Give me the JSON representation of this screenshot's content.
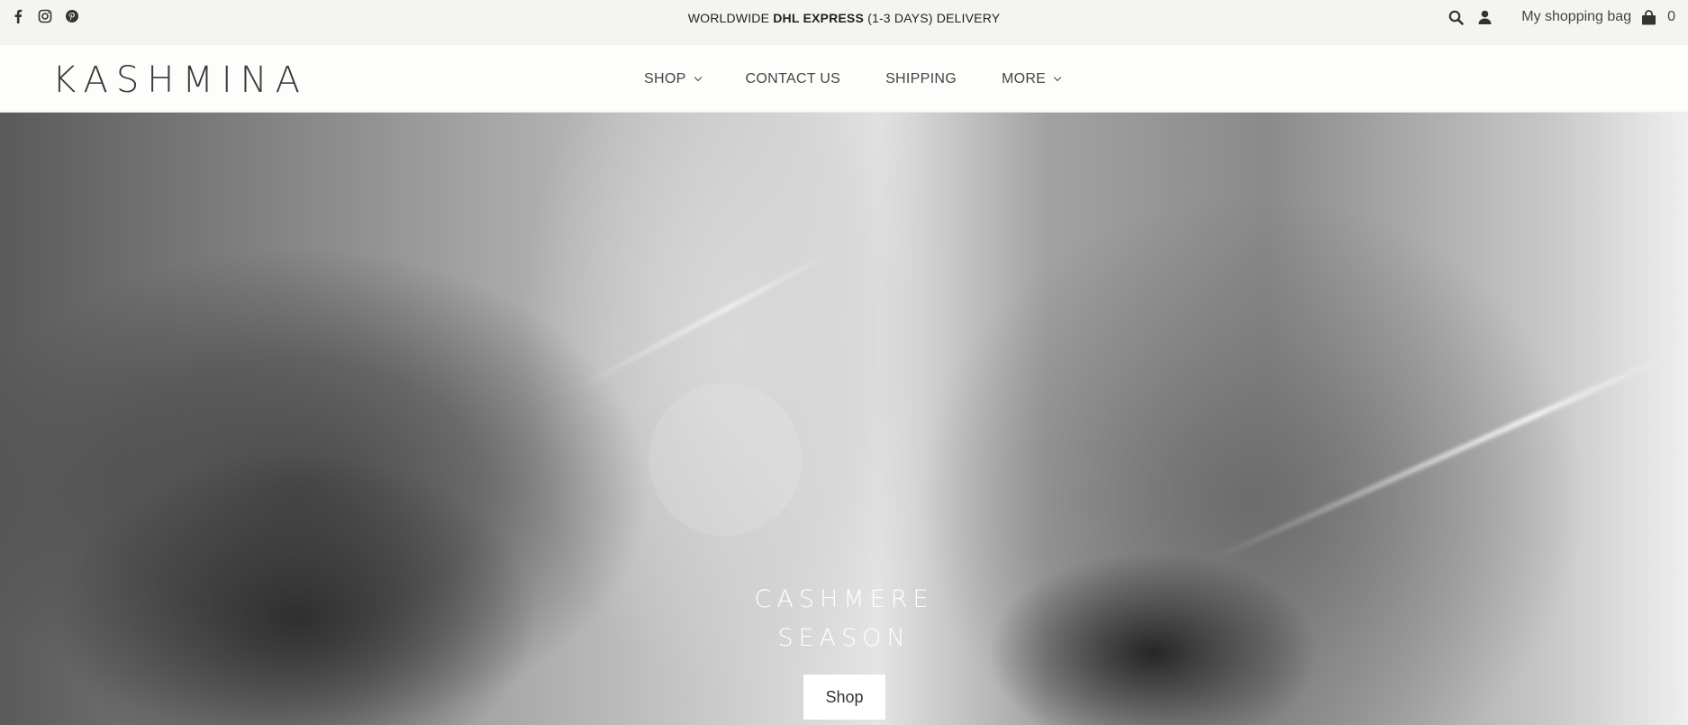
{
  "topbar": {
    "social": [
      {
        "name": "facebook-icon"
      },
      {
        "name": "instagram-icon"
      },
      {
        "name": "pinterest-icon"
      }
    ],
    "announcement_prefix": "WORLDWIDE ",
    "announcement_bold": "DHL EXPRESS",
    "announcement_suffix": " (1-3 DAYS) DELIVERY",
    "bag_label": "My shopping bag",
    "bag_count": "0"
  },
  "header": {
    "logo": "KASHMINA",
    "nav": [
      {
        "label": "SHOP",
        "dropdown": true
      },
      {
        "label": "CONTACT US",
        "dropdown": false
      },
      {
        "label": "SHIPPING",
        "dropdown": false
      },
      {
        "label": "MORE",
        "dropdown": true
      }
    ]
  },
  "hero": {
    "title_line1": "CASHMERE",
    "title_line2": "SEASON",
    "button_label": "Shop"
  }
}
